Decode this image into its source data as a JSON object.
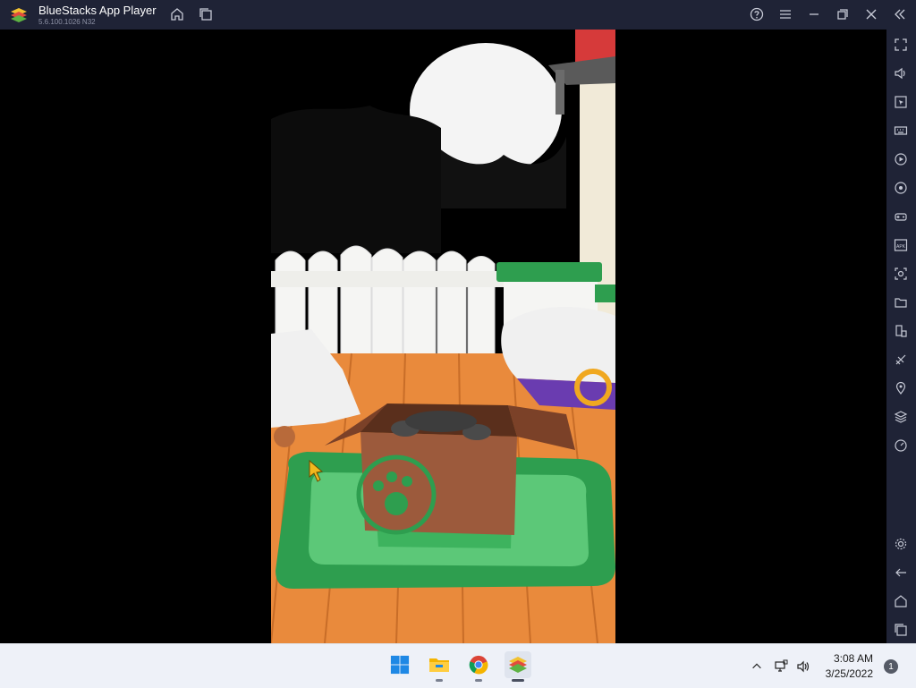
{
  "window": {
    "title": "BlueStacks App Player",
    "version": "5.6.100.1026 N32"
  },
  "titlebar": {
    "buttons": [
      "home-icon",
      "multi-instance-icon",
      "help-icon",
      "menu-icon",
      "minimize-icon",
      "restore-icon",
      "close-icon",
      "collapse-sidebar-icon"
    ]
  },
  "sidebar": {
    "buttons": [
      "fullscreen-icon",
      "volume-icon",
      "pointer-icon",
      "keyboard-icon",
      "macro-icon",
      "sync-icon",
      "gamepad-icon",
      "apk-icon",
      "screenshot-icon",
      "folder-icon",
      "rotate-icon",
      "eco-mode-icon",
      "location-icon",
      "layers-icon",
      "performance-icon",
      "settings-icon",
      "back-icon",
      "android-home-icon",
      "recent-apps-icon"
    ],
    "apk_label": "APK"
  },
  "colors": {
    "titlebar_bg": "#1f2336",
    "taskbar_bg": "#eef1f8",
    "rug_green": "#2e9e4f",
    "floor_orange": "#e98a3c"
  },
  "taskbar": {
    "apps": [
      "windows-start-icon",
      "file-explorer-icon",
      "chrome-icon",
      "bluestacks-icon"
    ],
    "time": "3:08 AM",
    "date": "3/25/2022",
    "notification_count": "1"
  }
}
